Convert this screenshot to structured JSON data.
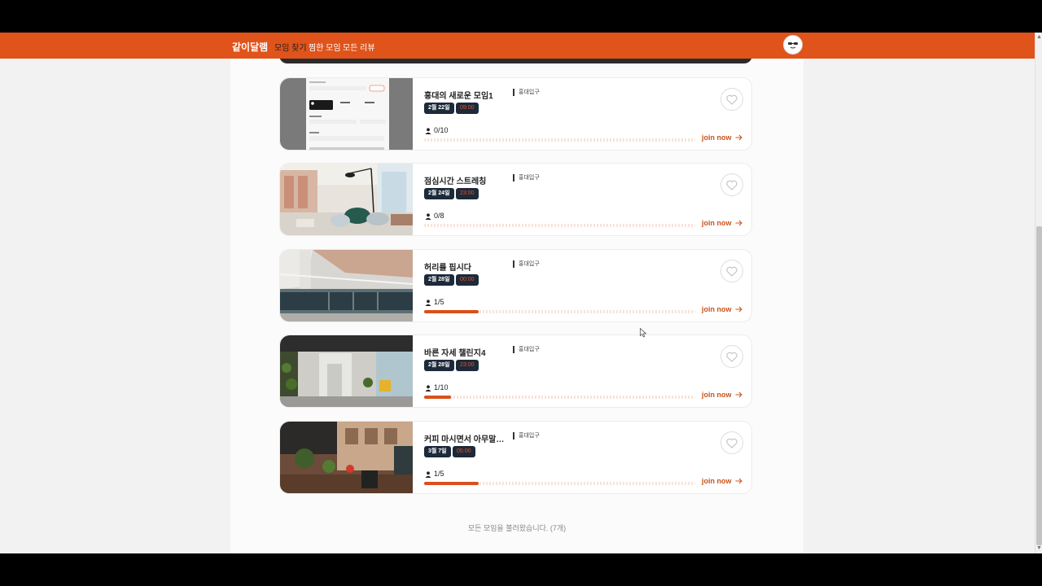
{
  "nav": {
    "logo": "같이달램",
    "links": [
      {
        "label": "모임 찾기",
        "active": true
      },
      {
        "label": "찜한 모임",
        "active": false
      },
      {
        "label": "모든 리뷰",
        "active": false
      }
    ],
    "brand_color": "#e0531a"
  },
  "cards": [
    {
      "title": "홍대의 새로운 모임1",
      "location": "홍대입구",
      "date": "2월 22일",
      "time": "09:00",
      "participants": "0/10",
      "fill_fraction": 0.0,
      "join_label": "join now",
      "image": "form-screenshot"
    },
    {
      "title": "점심시간 스트레칭",
      "location": "홍대입구",
      "date": "2월 24일",
      "time": "23:00",
      "participants": "0/8",
      "fill_fraction": 0.0,
      "join_label": "join now",
      "image": "bright-office-lounge"
    },
    {
      "title": "허리를 핍시다",
      "location": "홍대입구",
      "date": "2월 28일",
      "time": "00:00",
      "participants": "1/5",
      "fill_fraction": 0.2,
      "join_label": "join now",
      "image": "office-glass-interior"
    },
    {
      "title": "바른 자세 챌린지4",
      "location": "홍대입구",
      "date": "2월 28일",
      "time": "23:00",
      "participants": "1/10",
      "fill_fraction": 0.1,
      "join_label": "join now",
      "image": "corridor-with-plants"
    },
    {
      "title": "커피 마시면서 아무말도 안...",
      "location": "홍대입구",
      "date": "3월 7일",
      "time": "05:00",
      "participants": "1/5",
      "fill_fraction": 0.2,
      "join_label": "join now",
      "image": "cafe-terrace"
    }
  ],
  "footer": {
    "message": "모든 모임을 불러왔습니다. (7개)"
  }
}
